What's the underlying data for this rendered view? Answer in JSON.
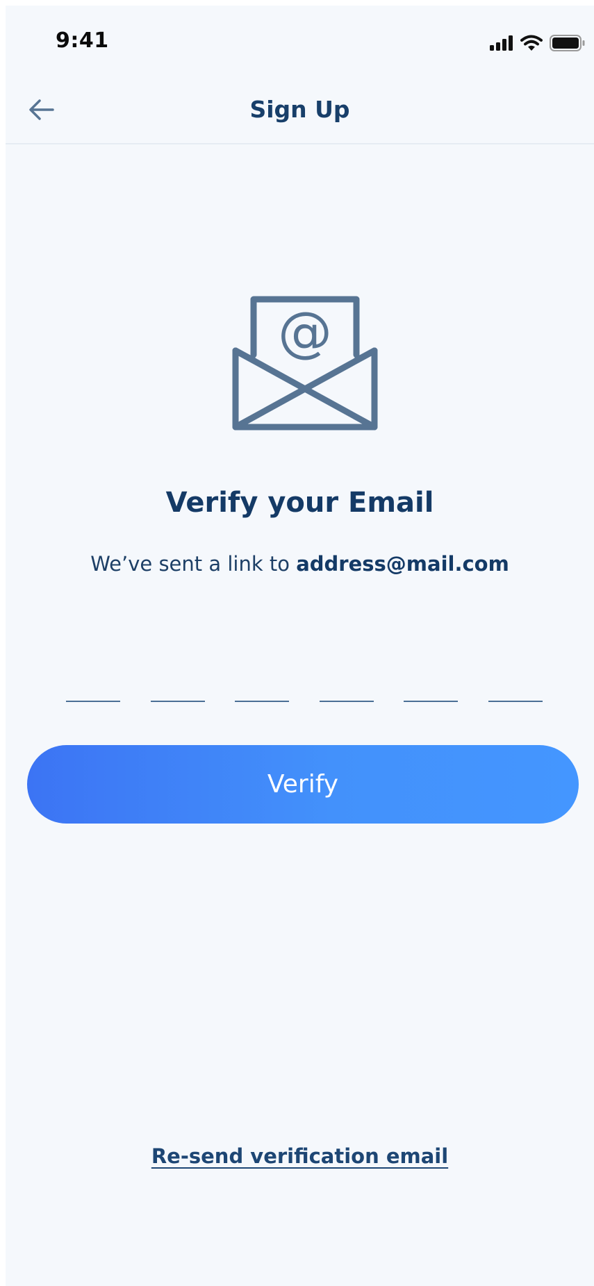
{
  "status_bar": {
    "time": "9:41"
  },
  "header": {
    "title": "Sign Up",
    "back_icon": "arrow-left-icon"
  },
  "illustration": {
    "icon": "open-envelope-at-icon",
    "color": "#577493"
  },
  "content": {
    "heading": "Verify your Email",
    "message_prefix": "We’ve sent a link to ",
    "email": "address@mail.com"
  },
  "code_inputs": [
    {
      "value": ""
    },
    {
      "value": ""
    },
    {
      "value": ""
    },
    {
      "value": ""
    },
    {
      "value": ""
    },
    {
      "value": ""
    }
  ],
  "verify_button": {
    "label": "Verify",
    "gradient_start": "#3c74f4",
    "gradient_end": "#4496ff"
  },
  "resend_link": {
    "label": "Re-send verification email"
  },
  "colors": {
    "background": "#f5f8fc",
    "primary_text": "#143a66"
  }
}
